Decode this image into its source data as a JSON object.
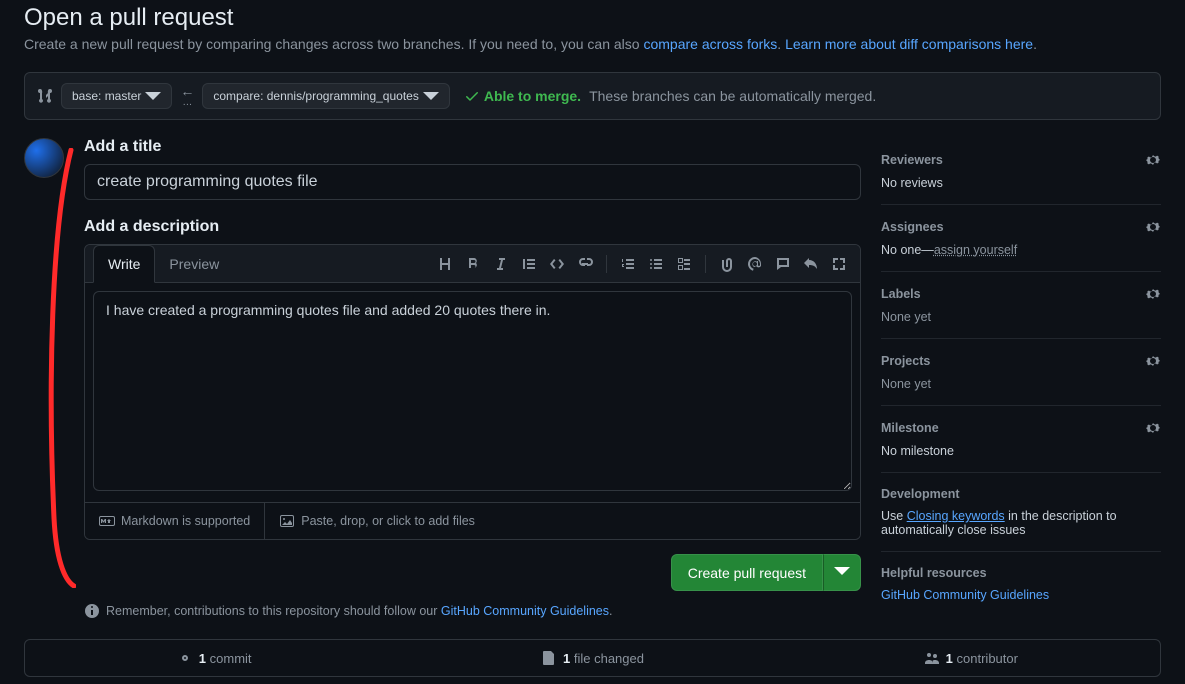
{
  "header": {
    "title": "Open a pull request",
    "subtitle_a": "Create a new pull request by comparing changes across two branches. If you need to, you can also ",
    "link_forks": "compare across forks",
    "subtitle_b": ". ",
    "link_diff": "Learn more about diff comparisons here",
    "subtitle_c": "."
  },
  "range": {
    "base_label": "base: master",
    "arrow_dots": "…",
    "compare_label": "compare: dennis/programming_quotes",
    "merge_ok": "Able to merge.",
    "merge_note": "These branches can be automatically merged."
  },
  "form": {
    "title_label": "Add a title",
    "title_value": "create programming quotes file",
    "desc_label": "Add a description",
    "write_tab": "Write",
    "preview_tab": "Preview",
    "body_value": "I have created a programming quotes file and added 20 quotes there in.",
    "markdown_hint": "Markdown is supported",
    "paste_hint": "Paste, drop, or click to add files",
    "submit_label": "Create pull request",
    "remember_a": "Remember, contributions to this repository should follow our ",
    "remember_link": "GitHub Community Guidelines",
    "remember_b": "."
  },
  "sidebar": {
    "reviewers": {
      "label": "Reviewers",
      "value": "No reviews"
    },
    "assignees": {
      "label": "Assignees",
      "value_a": "No one—",
      "link": "assign yourself"
    },
    "labels": {
      "label": "Labels",
      "value": "None yet"
    },
    "projects": {
      "label": "Projects",
      "value": "None yet"
    },
    "milestone": {
      "label": "Milestone",
      "value": "No milestone"
    },
    "development": {
      "label": "Development",
      "text_a": "Use ",
      "link": "Closing keywords",
      "text_b": " in the description to automatically close issues"
    },
    "resources": {
      "label": "Helpful resources",
      "link": "GitHub Community Guidelines"
    }
  },
  "stats": {
    "commit_n": "1",
    "commit_l": "commit",
    "file_n": "1",
    "file_l": "file changed",
    "contrib_n": "1",
    "contrib_l": "contributor"
  }
}
